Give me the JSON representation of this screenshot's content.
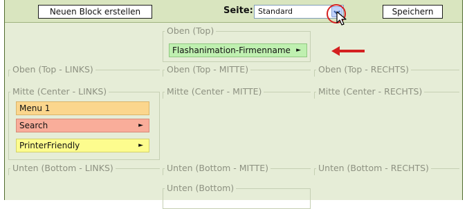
{
  "toolbar": {
    "new_block_label": "Neuen Block erstellen",
    "page_label": "Seite:",
    "page_select_value": "Standard",
    "save_label": "Speichern"
  },
  "regions": {
    "top": "Oben (Top)",
    "top_left": "Oben (Top - LINKS)",
    "top_middle": "Oben (Top - MITTE)",
    "top_right": "Oben (Top - RECHTS)",
    "center_left": "Mitte (Center - LINKS)",
    "center_middle": "Mitte (Center - MITTE)",
    "center_right": "Mitte (Center - RECHTS)",
    "bottom_left": "Unten (Bottom - LINKS)",
    "bottom_middle": "Unten (Bottom - MITTE)",
    "bottom_right": "Unten (Bottom - RECHTS)",
    "bottom": "Unten (Bottom)"
  },
  "blocks": {
    "flash": {
      "label": "Flashanimation-Firmenname",
      "arrow": "►"
    },
    "menu1": {
      "label": "Menu 1"
    },
    "search": {
      "label": "Search",
      "arrow": "►"
    },
    "printer": {
      "label": "PrinterFriendly",
      "arrow": "►"
    }
  },
  "icons": {
    "select_arrow": "chevron-down-icon",
    "cursor": "mouse-pointer-icon",
    "annotation_arrow": "red-left-arrow-icon"
  },
  "colors": {
    "background": "#e6edd7",
    "toolbar": "#d9e5bf",
    "block_green": "#bff0b0",
    "block_orange": "#fbd68d",
    "block_salmon": "#f9ad9a",
    "block_yellow": "#fdfc8e",
    "annotation_red": "#d42020"
  }
}
